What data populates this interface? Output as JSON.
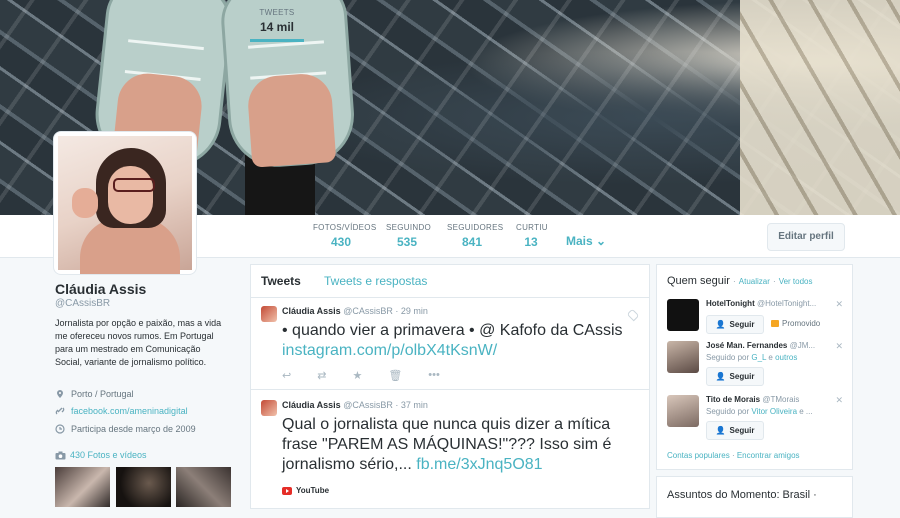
{
  "profile": {
    "name": "Cláudia Assis",
    "handle": "@CAssisBR",
    "bio": "Jornalista por opção e paixão, mas a vida me ofereceu novos rumos. Em Portugal para um mestrado em Comunicação Social, variante de jornalismo político.",
    "location": "Porto / Portugal",
    "website": "facebook.com/ameninadigital",
    "joined": "Participa desde março de 2009",
    "photos_link": "430 Fotos e vídeos"
  },
  "nav": {
    "stats": [
      {
        "label": "TWEETS",
        "value": "14 mil"
      },
      {
        "label": "FOTOS/VÍDEOS",
        "value": "430"
      },
      {
        "label": "SEGUINDO",
        "value": "535"
      },
      {
        "label": "SEGUIDORES",
        "value": "841"
      },
      {
        "label": "CURTIU",
        "value": "13"
      }
    ],
    "more": "Mais",
    "edit_profile": "Editar perfil"
  },
  "timeline": {
    "tab_tweets": "Tweets",
    "tab_replies": "Tweets e respostas",
    "tweets": [
      {
        "name": "Cláudia Assis",
        "handle": "@CAssisBR",
        "time": "· 29 min",
        "text": "• quando vier a primavera • @ Kafofo da CAssis ",
        "link": "instagram.com/p/olbX4tKsnW/"
      },
      {
        "name": "Cláudia Assis",
        "handle": "@CAssisBR",
        "time": "· 37 min",
        "text": "Qual o jornalista que nunca quis dizer a mítica frase \"PAREM AS MÁQUINAS!\"??? Isso sim é jornalismo sério,... ",
        "link": "fb.me/3xJnq5O81",
        "card": "YouTube"
      }
    ]
  },
  "who_to_follow": {
    "title": "Quem seguir",
    "refresh": "Atualizar",
    "view_all": "Ver todos",
    "suggestions": [
      {
        "name": "HotelTonight",
        "handle": "@HotelTonight...",
        "follow": "Seguir",
        "promoted": "Promovido"
      },
      {
        "name": "José Man. Fernandes",
        "handle": "@JM...",
        "followed_by_prefix": "Seguido por ",
        "followed_by": "G_L",
        "followed_by_suffix": " e ",
        "others": "outros",
        "follow": "Seguir"
      },
      {
        "name": "Tito de Morais",
        "handle": "@TMorais",
        "followed_by_prefix": "Seguido por ",
        "followed_by": "Vitor Oliveira",
        "followed_by_suffix": " e ...",
        "follow": "Seguir"
      }
    ],
    "popular": "Contas populares",
    "find_friends": "Encontrar amigos"
  },
  "trends": {
    "title": "Assuntos do Momento: Brasil ·"
  },
  "colors": {
    "accent": "#4ab3c2",
    "text": "#292f33",
    "muted": "#8899a6"
  }
}
